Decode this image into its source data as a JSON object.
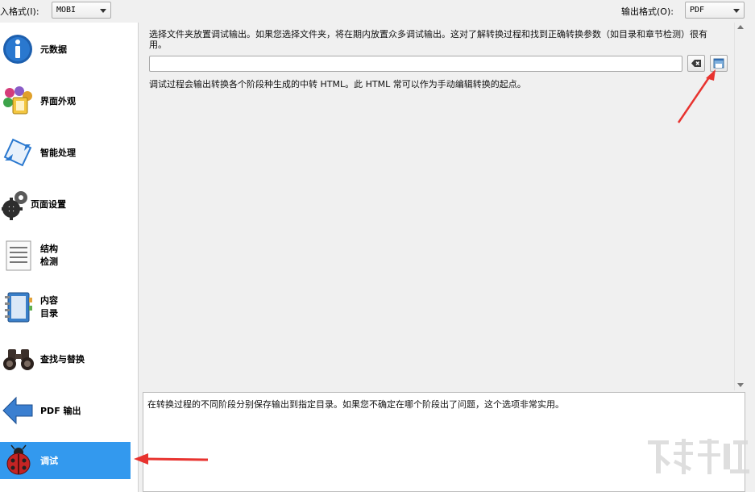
{
  "toolbar": {
    "input_format_label": "入格式(I):",
    "input_format_value": "MOBI",
    "output_format_label": "输出格式(O):",
    "output_format_value": "PDF"
  },
  "sidebar": {
    "items": [
      {
        "label": "元数据",
        "icon": "info-icon"
      },
      {
        "label": "界面外观",
        "icon": "paint-icon"
      },
      {
        "label": "智能处理",
        "icon": "wand-icon"
      },
      {
        "label": "页面设置",
        "icon": "gear-icon"
      },
      {
        "label": "结构\n检测",
        "icon": "document-icon"
      },
      {
        "label": "内容\n目录",
        "icon": "notebook-icon"
      },
      {
        "label": "查找与替换",
        "icon": "binoculars-icon"
      },
      {
        "label": "PDF 输出",
        "icon": "arrow-left-icon"
      },
      {
        "label": "调试",
        "icon": "ladybug-icon"
      }
    ],
    "active_index": 8
  },
  "main": {
    "description": "选择文件夹放置调试输出。如果您选择文件夹，将在期内放置众多调试输出。这对了解转换过程和找到正确转换参数（如目录和章节检测）很有用。",
    "folder_path": "",
    "note": "调试过程会输出转换各个阶段种生成的中转 HTML。此 HTML 常可以作为手动编辑转换的起点。"
  },
  "help": {
    "text": "在转换过程的不同阶段分别保存输出到指定目录。如果您不确定在哪个阶段出了问题，这个选项非常实用。"
  },
  "colors": {
    "active_item": "#3399ee",
    "annotation_arrow": "#e8332f"
  }
}
